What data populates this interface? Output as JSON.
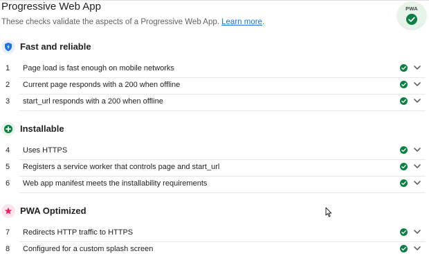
{
  "header": {
    "title": "Progressive Web App",
    "description": "These checks validate the aspects of a Progressive Web App.",
    "learn_more": "Learn more",
    "badge_text": "PWA",
    "badge_icon": "check-circle-icon"
  },
  "colors": {
    "pass": "#0b8043",
    "fast_icon": "#1a73e8",
    "installable_icon": "#0b8043",
    "optimized_icon": "#e91e63",
    "link": "#1a73e8"
  },
  "groups": [
    {
      "title": "Fast and reliable",
      "icon": "lightning-bolt-icon",
      "audits": [
        {
          "num": "1",
          "label": "Page load is fast enough on mobile networks",
          "status": "pass"
        },
        {
          "num": "2",
          "label": "Current page responds with a 200 when offline",
          "status": "pass"
        },
        {
          "num": "3",
          "label": "start_url responds with a 200 when offline",
          "status": "pass"
        }
      ]
    },
    {
      "title": "Installable",
      "icon": "plus-icon",
      "audits": [
        {
          "num": "4",
          "label": "Uses HTTPS",
          "status": "pass"
        },
        {
          "num": "5",
          "label": "Registers a service worker that controls page and start_url",
          "status": "pass"
        },
        {
          "num": "6",
          "label": "Web app manifest meets the installability requirements",
          "status": "pass"
        }
      ]
    },
    {
      "title": "PWA Optimized",
      "icon": "star-icon",
      "audits": [
        {
          "num": "7",
          "label": "Redirects HTTP traffic to HTTPS",
          "status": "pass"
        },
        {
          "num": "8",
          "label": "Configured for a custom splash screen",
          "status": "pass"
        }
      ]
    }
  ]
}
